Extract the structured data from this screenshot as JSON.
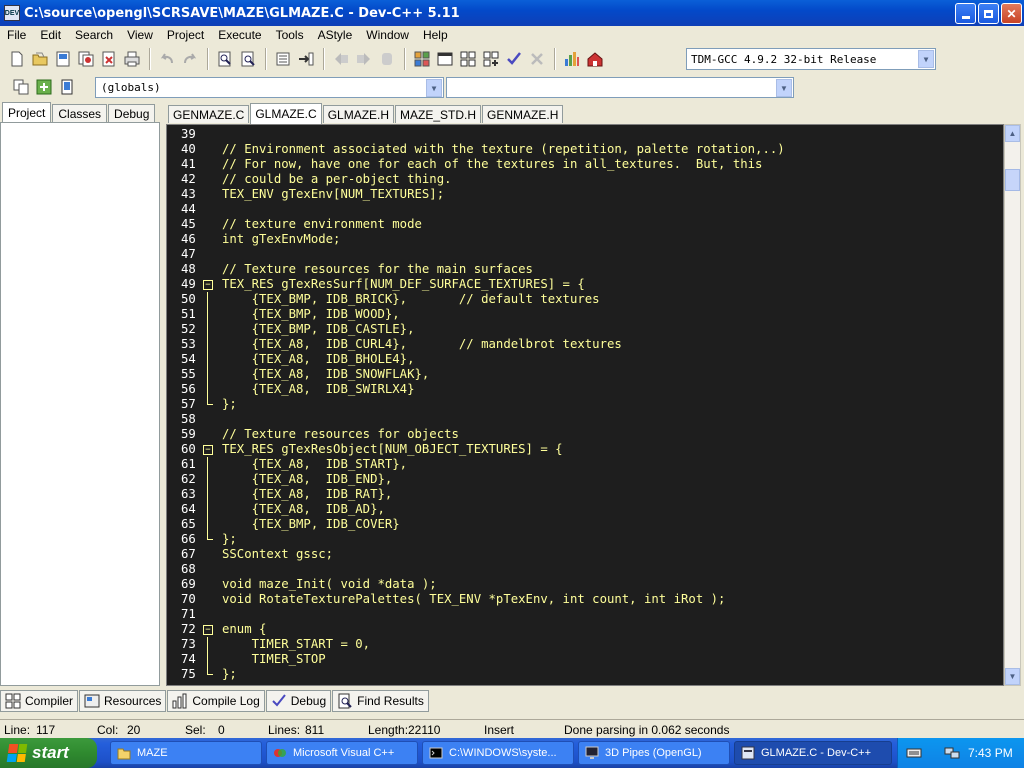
{
  "window": {
    "title": "C:\\source\\opengl\\SCRSAVE\\MAZE\\GLMAZE.C - Dev-C++ 5.11",
    "icon_label": "DEV"
  },
  "menu": [
    "File",
    "Edit",
    "Search",
    "View",
    "Project",
    "Execute",
    "Tools",
    "AStyle",
    "Window",
    "Help"
  ],
  "toolbar": {
    "compiler": "TDM-GCC 4.9.2 32-bit Release",
    "scope": "(globals)"
  },
  "left_tabs": [
    "Project",
    "Classes",
    "Debug"
  ],
  "editor_tabs": [
    "GENMAZE.C",
    "GLMAZE.C",
    "GLMAZE.H",
    "MAZE_STD.H",
    "GENMAZE.H"
  ],
  "active_editor_tab": 1,
  "code_lines": [
    {
      "n": "39",
      "t": "",
      "f": ""
    },
    {
      "n": "40",
      "t": "// Environment associated with the texture (repetition, palette rotation,..)",
      "f": ""
    },
    {
      "n": "41",
      "t": "// For now, have one for each of the textures in all_textures.  But, this",
      "f": ""
    },
    {
      "n": "42",
      "t": "// could be a per-object thing.",
      "f": ""
    },
    {
      "n": "43",
      "t": "TEX_ENV gTexEnv[NUM_TEXTURES];",
      "f": ""
    },
    {
      "n": "44",
      "t": "",
      "f": ""
    },
    {
      "n": "45",
      "t": "// texture environment mode",
      "f": ""
    },
    {
      "n": "46",
      "t": "int gTexEnvMode;",
      "f": ""
    },
    {
      "n": "47",
      "t": "",
      "f": ""
    },
    {
      "n": "48",
      "t": "// Texture resources for the main surfaces",
      "f": ""
    },
    {
      "n": "49",
      "t": "TEX_RES gTexResSurf[NUM_DEF_SURFACE_TEXTURES] = {",
      "f": "open"
    },
    {
      "n": "50",
      "t": "    {TEX_BMP, IDB_BRICK},       // default textures",
      "f": "line"
    },
    {
      "n": "51",
      "t": "    {TEX_BMP, IDB_WOOD},",
      "f": "line"
    },
    {
      "n": "52",
      "t": "    {TEX_BMP, IDB_CASTLE},",
      "f": "line"
    },
    {
      "n": "53",
      "t": "    {TEX_A8,  IDB_CURL4},       // mandelbrot textures",
      "f": "line"
    },
    {
      "n": "54",
      "t": "    {TEX_A8,  IDB_BHOLE4},",
      "f": "line"
    },
    {
      "n": "55",
      "t": "    {TEX_A8,  IDB_SNOWFLAK},",
      "f": "line"
    },
    {
      "n": "56",
      "t": "    {TEX_A8,  IDB_SWIRLX4}",
      "f": "line"
    },
    {
      "n": "57",
      "t": "};",
      "f": "end"
    },
    {
      "n": "58",
      "t": "",
      "f": ""
    },
    {
      "n": "59",
      "t": "// Texture resources for objects",
      "f": ""
    },
    {
      "n": "60",
      "t": "TEX_RES gTexResObject[NUM_OBJECT_TEXTURES] = {",
      "f": "open"
    },
    {
      "n": "61",
      "t": "    {TEX_A8,  IDB_START},",
      "f": "line"
    },
    {
      "n": "62",
      "t": "    {TEX_A8,  IDB_END},",
      "f": "line"
    },
    {
      "n": "63",
      "t": "    {TEX_A8,  IDB_RAT},",
      "f": "line"
    },
    {
      "n": "64",
      "t": "    {TEX_A8,  IDB_AD},",
      "f": "line"
    },
    {
      "n": "65",
      "t": "    {TEX_BMP, IDB_COVER}",
      "f": "line"
    },
    {
      "n": "66",
      "t": "};",
      "f": "end"
    },
    {
      "n": "67",
      "t": "SSContext gssc;",
      "f": ""
    },
    {
      "n": "68",
      "t": "",
      "f": ""
    },
    {
      "n": "69",
      "t": "void maze_Init( void *data );",
      "f": ""
    },
    {
      "n": "70",
      "t": "void RotateTexturePalettes( TEX_ENV *pTexEnv, int count, int iRot );",
      "f": ""
    },
    {
      "n": "71",
      "t": "",
      "f": ""
    },
    {
      "n": "72",
      "t": "enum {",
      "f": "open"
    },
    {
      "n": "73",
      "t": "    TIMER_START = 0,",
      "f": "line"
    },
    {
      "n": "74",
      "t": "    TIMER_STOP",
      "f": "line"
    },
    {
      "n": "75",
      "t": "};",
      "f": "end"
    }
  ],
  "bottom_tabs": [
    "Compiler",
    "Resources",
    "Compile Log",
    "Debug",
    "Find Results"
  ],
  "status": {
    "line_label": "Line:",
    "line": "117",
    "col_label": "Col:",
    "col": "20",
    "sel_label": "Sel:",
    "sel": "0",
    "lines_label": "Lines:",
    "lines": "811",
    "length_label": "Length:",
    "length": "22110",
    "mode": "Insert",
    "message": "Done parsing in 0.062 seconds"
  },
  "taskbar": {
    "start": "start",
    "tasks": [
      "MAZE",
      "Microsoft Visual C++",
      "C:\\WINDOWS\\syste...",
      "3D Pipes (OpenGL)",
      "GLMAZE.C - Dev-C++"
    ],
    "clock": "7:43 PM"
  },
  "colors": {
    "editor_bg": "#1e1e1e",
    "code_fg": "#ffff9a",
    "title_bar": "#0349c9"
  }
}
